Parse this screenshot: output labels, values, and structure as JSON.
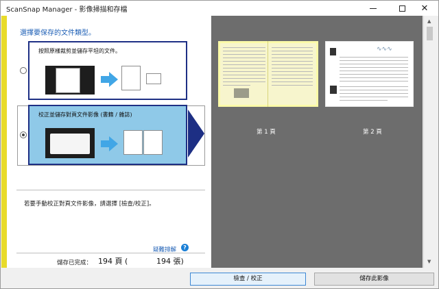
{
  "window": {
    "title": "ScanSnap Manager - 影像掃描和存檔"
  },
  "left_panel": {
    "prompt": "選擇要保存的文件類型。",
    "options": [
      {
        "label": "按照原樣裁剪並儲存平坦的文件。",
        "selected": false
      },
      {
        "label": "校正並儲存對頁文件影像 (書籍 / 雜誌)",
        "selected": true
      }
    ],
    "info_text": "若要手動校正對頁文件影像，請選擇 [檢查/校正]。",
    "help_link": "疑難排解",
    "help_icon": "question-icon",
    "status": {
      "label": "儲存已完成：",
      "pages": "194 頁 (",
      "sheets": "194 張)"
    }
  },
  "preview": {
    "pages": [
      {
        "caption": "第 1 頁"
      },
      {
        "caption": "第 2 頁"
      }
    ]
  },
  "buttons": {
    "check": "檢查 / 校正",
    "save": "儲存此影像"
  },
  "colors": {
    "accent_yellow": "#e8db2a",
    "selection_blue": "#8fc9e8",
    "frame_navy": "#1d2f84",
    "link_blue": "#1d5fb5",
    "preview_gray": "#6d6d6d"
  }
}
